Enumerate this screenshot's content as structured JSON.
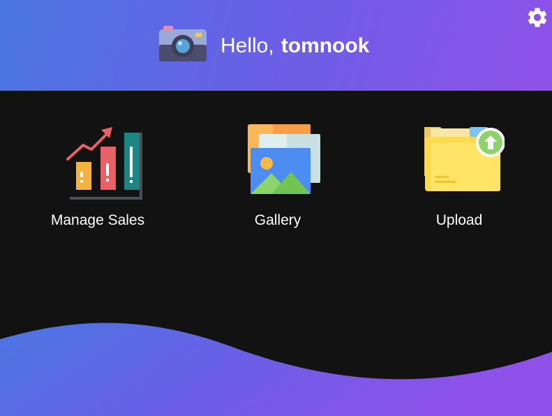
{
  "header": {
    "greeting_prefix": "Hello,",
    "username": "tomnook",
    "logo_icon": "camera-icon",
    "settings_icon": "gear-icon"
  },
  "tiles": [
    {
      "label": "Manage Sales",
      "icon": "sales-chart-icon"
    },
    {
      "label": "Gallery",
      "icon": "gallery-photos-icon"
    },
    {
      "label": "Upload",
      "icon": "folder-upload-icon"
    }
  ],
  "colors": {
    "background": "#121212",
    "gradient_start": "#4a76e2",
    "gradient_end": "#8f51e9",
    "text": "#ffffff"
  }
}
